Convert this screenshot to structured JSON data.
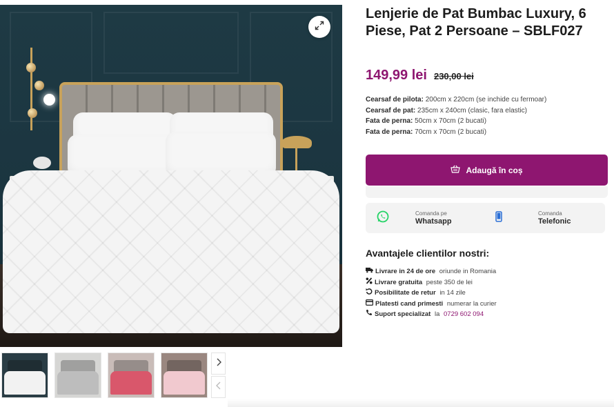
{
  "product": {
    "title": "Lenjerie de Pat Bumbac Luxury, 6 Piese, Pat 2 Persoane – SBLF027",
    "price_current": "149,99 lei",
    "price_old": "230,00 lei",
    "specs": [
      {
        "label": "Cearsaf de pilota:",
        "value": "200cm x 220cm (se inchide cu fermoar)"
      },
      {
        "label": "Cearsaf de pat:",
        "value": "235cm x 240cm (clasic, fara elastic)"
      },
      {
        "label": "Fata de perna:",
        "value": "50cm x 70cm (2 bucati)"
      },
      {
        "label": "Fata de perna:",
        "value": "70cm x 70cm (2 bucati)"
      }
    ]
  },
  "cart": {
    "button_label": "Adaugă în coș",
    "icon": "basket-icon"
  },
  "order": {
    "whatsapp": {
      "small": "Comanda pe",
      "big": "Whatsapp",
      "icon": "whatsapp-icon"
    },
    "phone": {
      "small": "Comanda",
      "big": "Telefonic",
      "icon": "phone-icon"
    }
  },
  "benefits": {
    "title": "Avantajele clientilor nostri:",
    "items": [
      {
        "icon": "truck-icon",
        "strong": "Livrare in 24 de ore",
        "rest": " oriunde in Romania"
      },
      {
        "icon": "percent-icon",
        "strong": "Livrare gratuita",
        "rest": " peste 350 de lei"
      },
      {
        "icon": "return-icon",
        "strong": "Posibilitate de retur",
        "rest": " in 14 zile"
      },
      {
        "icon": "card-icon",
        "strong": "Platesti cand primesti",
        "rest": " numerar la curier"
      },
      {
        "icon": "phone-icon",
        "strong": "Suport specializat",
        "rest": " la ",
        "link": "0729 602 094"
      }
    ]
  },
  "gallery": {
    "expand_icon": "expand-icon",
    "thumbnails": [
      {
        "name": "thumbnail-white",
        "color": "#f2f2f2",
        "bg": "#2a3d45"
      },
      {
        "name": "thumbnail-grey",
        "color": "#bdbdbd",
        "bg": "#d6d6d4"
      },
      {
        "name": "thumbnail-red",
        "color": "#d9576b",
        "bg": "#c9bcb8"
      },
      {
        "name": "thumbnail-pink",
        "color": "#f1c9cf",
        "bg": "#9a8780"
      }
    ]
  },
  "colors": {
    "accent": "#8e1670",
    "whatsapp_green": "#25d366",
    "phone_blue": "#2b6fd6"
  }
}
